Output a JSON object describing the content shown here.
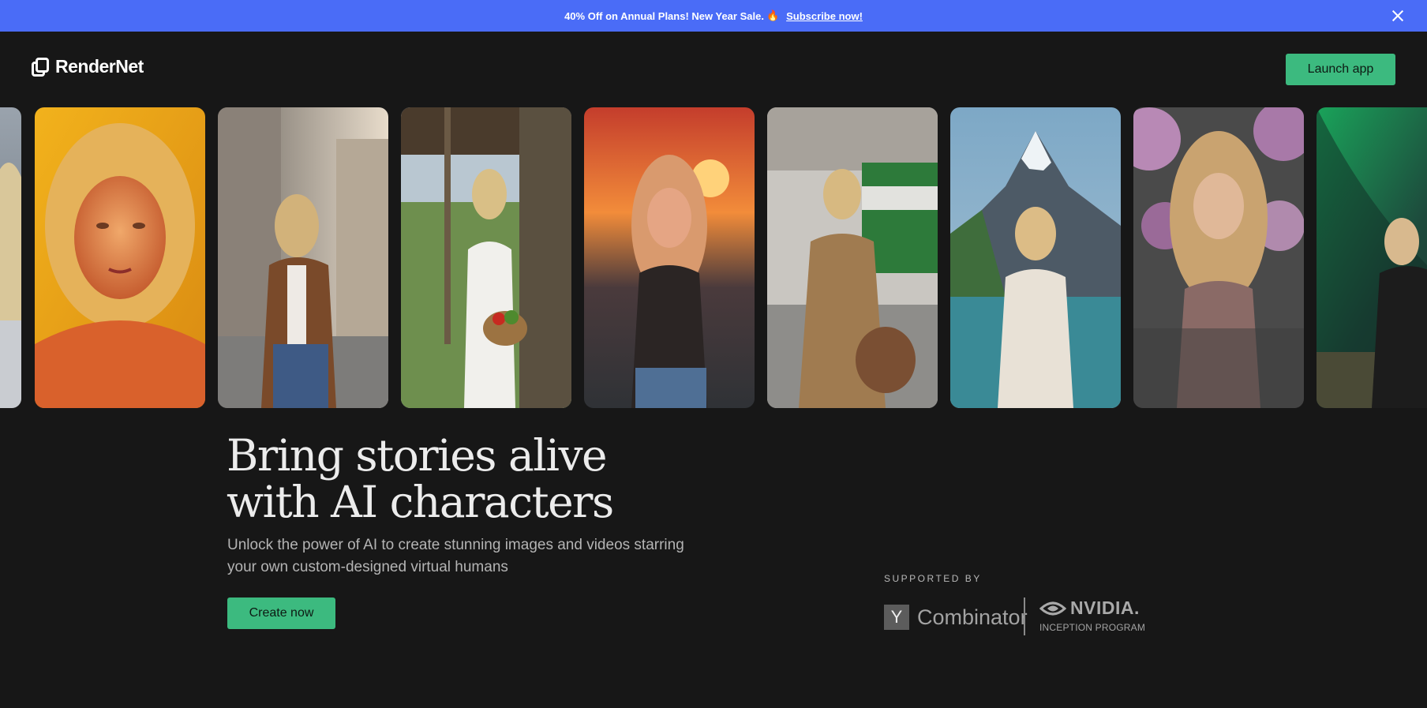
{
  "promo": {
    "text": "40% Off on Annual Plans! New Year Sale.",
    "emoji": "🔥",
    "link": "Subscribe now!"
  },
  "header": {
    "brand": "RenderNet",
    "launch_label": "Launch app"
  },
  "gallery": {
    "cards": [
      {
        "theme": "snowy-partial"
      },
      {
        "theme": "golden-portrait"
      },
      {
        "theme": "city-street-coffee"
      },
      {
        "theme": "farm-porch-basket"
      },
      {
        "theme": "sunset-rooftop"
      },
      {
        "theme": "tram-station-coat"
      },
      {
        "theme": "mountain-lake"
      },
      {
        "theme": "purple-flowers"
      },
      {
        "theme": "aurora-partial"
      }
    ]
  },
  "hero": {
    "title_line1": "Bring stories alive",
    "title_line2": "with AI characters",
    "subtitle_line1": "Unlock the power of AI to create stunning images and videos starring",
    "subtitle_line2": "your own custom-designed virtual humans",
    "cta_label": "Create now"
  },
  "supporters": {
    "heading": "SUPPORTED BY",
    "yc_mark": "Y",
    "yc_name": "Combinator",
    "nvidia_name": "NVIDIA.",
    "nvidia_program": "INCEPTION PROGRAM"
  },
  "colors": {
    "background": "#171717",
    "promo": "#4a6cf7",
    "accent": "#3cba7f"
  }
}
